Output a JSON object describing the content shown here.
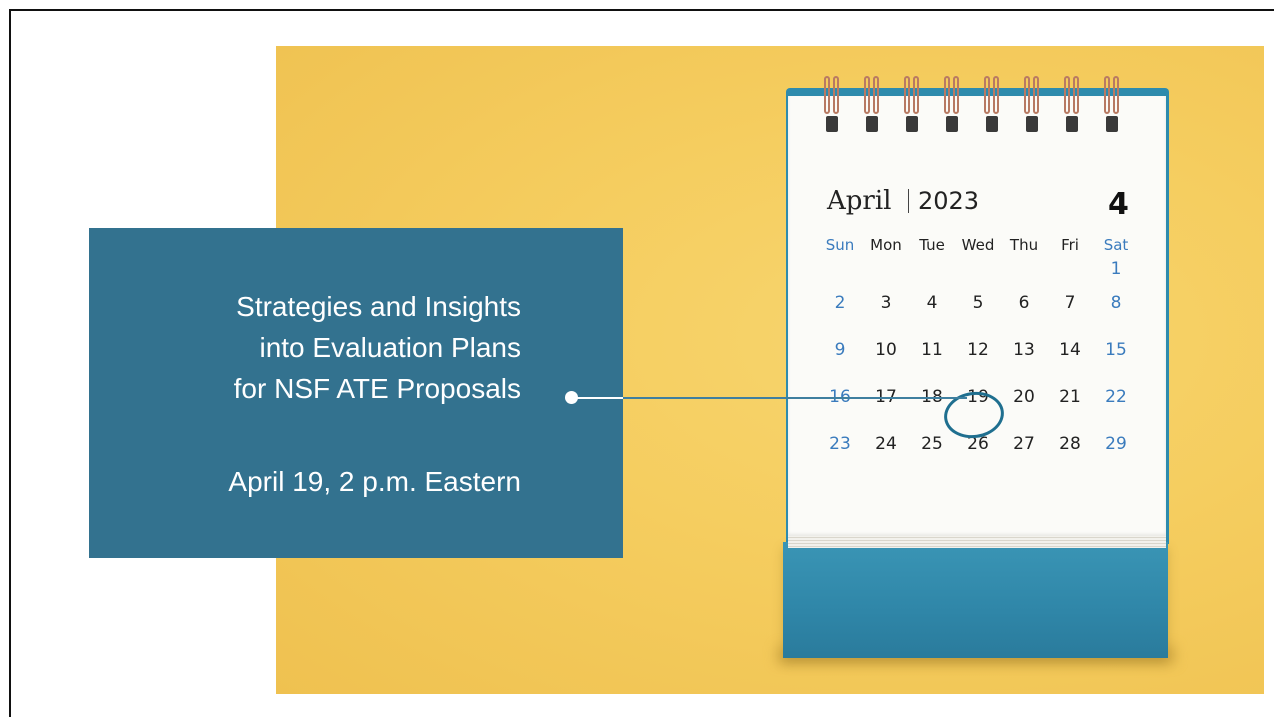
{
  "event": {
    "title_lines": [
      "Strategies and Insights",
      "into Evaluation Plans",
      "for NSF ATE Proposals"
    ],
    "date_time": "April 19, 2 p.m. Eastern"
  },
  "calendar": {
    "month": "April",
    "year": "2023",
    "month_number": "4",
    "weekdays": [
      "Sun",
      "Mon",
      "Tue",
      "Wed",
      "Thu",
      "Fri",
      "Sat"
    ],
    "weeks": [
      [
        "",
        "",
        "",
        "",
        "",
        "",
        "1"
      ],
      [
        "2",
        "3",
        "4",
        "5",
        "6",
        "7",
        "8"
      ],
      [
        "9",
        "10",
        "11",
        "12",
        "13",
        "14",
        "15"
      ],
      [
        "16",
        "17",
        "18",
        "19",
        "20",
        "21",
        "22"
      ],
      [
        "23",
        "24",
        "25",
        "26",
        "27",
        "28",
        "29"
      ]
    ],
    "highlighted_day": "19"
  },
  "colors": {
    "info_box": "#33728f",
    "background_photo": "#f5cd5f",
    "calendar_blue": "#2e8bad",
    "weekend_text": "#3a7bbd"
  }
}
